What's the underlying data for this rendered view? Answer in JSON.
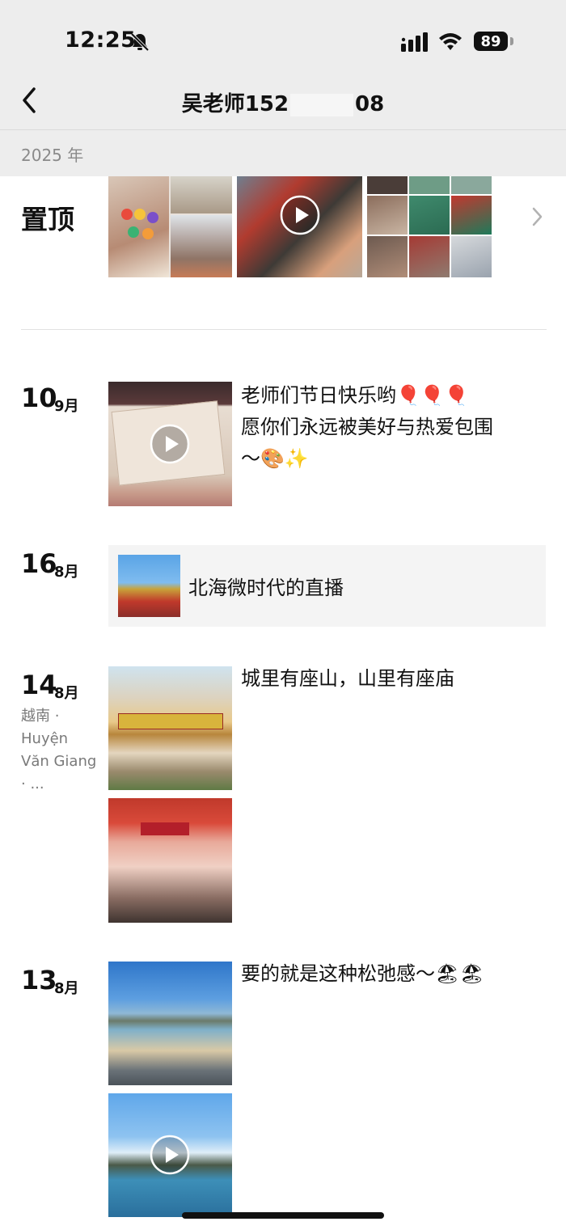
{
  "status_bar": {
    "time": "12:25",
    "battery": "89"
  },
  "nav": {
    "title_prefix": "吴老师152",
    "title_suffix": "08"
  },
  "year": "2025 年",
  "pinned": {
    "label": "置顶"
  },
  "posts": [
    {
      "day": "10",
      "month": "9月",
      "text_line1": "老师们节日快乐哟🎈🎈🎈",
      "text_line2": "愿你们永远被美好与热爱包围",
      "text_line3": "～🎨✨"
    },
    {
      "day": "16",
      "month": "8月",
      "share_title": "北海微时代的直播"
    },
    {
      "day": "14",
      "month": "8月",
      "location": "越南 · Huyện Văn Giang · ...",
      "text": "城里有座山，山里有座庙"
    },
    {
      "day": "13",
      "month": "8月",
      "text": "要的就是这种松弛感～🏖🏖"
    }
  ],
  "icons": [
    "mute-icon",
    "signal-icon",
    "wifi-icon",
    "back-icon",
    "chevron-right-icon",
    "play-icon"
  ]
}
